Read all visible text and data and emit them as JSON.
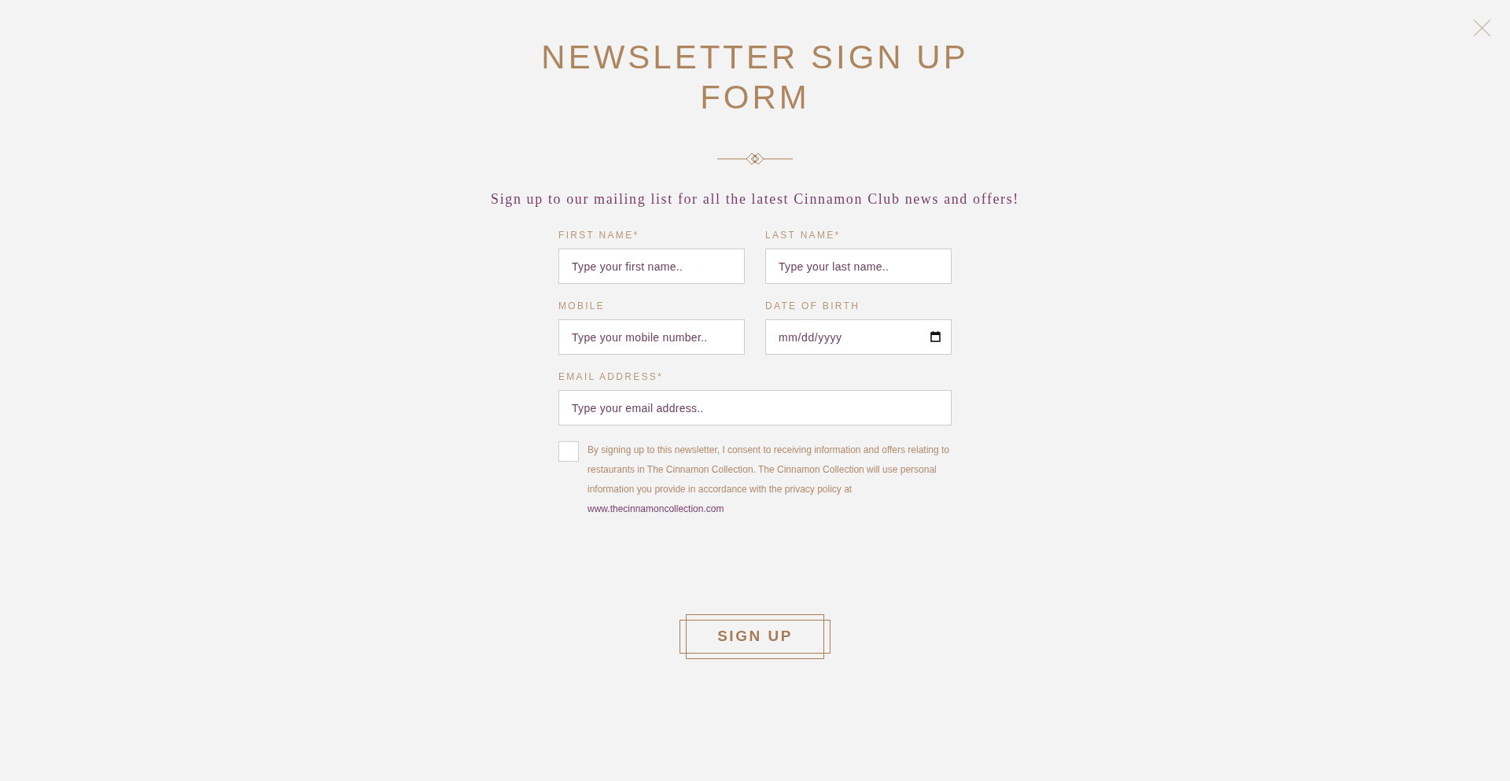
{
  "title": "NEWSLETTER SIGN UP FORM",
  "subtitle": "Sign up to our mailing list for all the latest Cinnamon Club news and offers!",
  "form_rows": [
    [
      {
        "kind": "text",
        "label": "FIRST NAME*",
        "placeholder": "Type your first name.."
      },
      {
        "kind": "text",
        "label": "LAST NAME*",
        "placeholder": "Type your last name.."
      }
    ],
    [
      {
        "kind": "text",
        "label": "MOBILE",
        "placeholder": "Type your mobile number.."
      },
      {
        "kind": "date",
        "label": "DATE OF BIRTH",
        "placeholder": "mm/dd/yyyy"
      }
    ],
    [
      {
        "kind": "text",
        "label": "EMAIL ADDRESS*",
        "placeholder": "Type your email address.."
      }
    ]
  ],
  "consent": {
    "checked": false,
    "text": "By signing up to this newsletter, I consent to receiving information and offers relating to restaurants in The Cinnamon Collection. The Cinnamon Collection will use personal information you provide in accordance with the privacy policy at",
    "link": "www.thecinnamoncollection.com"
  },
  "submit_button": {
    "label": "SIGN UP"
  }
}
